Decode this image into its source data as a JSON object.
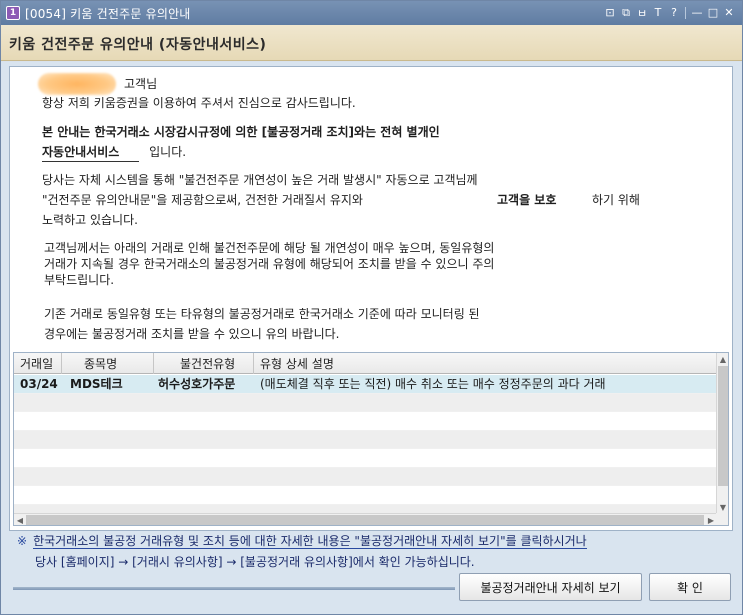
{
  "window": {
    "title": "[0054] 키움 건전주문 유의안내",
    "app_badge": "1",
    "tools": [
      "⊡",
      "⧉",
      "ㅂ",
      "T",
      "?",
      "—",
      "□",
      "✕"
    ]
  },
  "header": {
    "title": "키움 건전주문 유의안내 (자동안내서비스)"
  },
  "intro": {
    "customer_suffix": "고객님",
    "thanks": "항상 저희 키움증권을 이용하여 주셔서 진심으로 감사드립니다."
  },
  "notice": {
    "line1": "본 안내는 한국거래소 시장감시규정에 의한 [불공정거래 조치]와는 전혀 별개인",
    "line2_bold": "자동안내서비스",
    "line2_rest": "입니다."
  },
  "para1": {
    "line1": "당사는 자체 시스템을 통해 \"불건전주문 개연성이 높은 거래 발생시\" 자동으로 고객님께",
    "line2a": "\"건전주문 유의안내문\"을 제공함으로써, 건전한 거래질서 유지와",
    "line2_bold": "고객을 보호",
    "line2b": "하기 위해",
    "line3": "노력하고 있습니다."
  },
  "para2": {
    "line1": "고객님께서는 아래의 거래로 인해 불건전주문에 해당 될 개연성이 매우 높으며, 동일유형의",
    "line2": "거래가 지속될 경우 한국거래소의 불공정거래 유형에 해당되어 조치를 받을 수 있으니 주의",
    "line3": "부탁드립니다."
  },
  "para3": {
    "line1": "기존 거래로 동일유형 또는 타유형의 불공정거래로 한국거래소 기준에 따라 모니터링 된",
    "line2": "경우에는 불공정거래 조치를 받을 수 있으니 유의 바랍니다."
  },
  "grid": {
    "columns": [
      "거래일",
      "종목명",
      "불건전유형",
      "유형 상세 설명"
    ],
    "rows": [
      {
        "date": "03/24",
        "name": "MDS테크",
        "type": "허수성호가주문",
        "detail": "(매도체결 직후 또는 직전) 매수 취소 또는 매수 정정주문의 과다 거래"
      }
    ],
    "empty_row_count": 7
  },
  "footer_note": {
    "mark": "※",
    "line1": "한국거래소의 불공정 거래유형 및 조치 등에 대한 자세한 내용은 \"불공정거래안내 자세히 보기\"를 클릭하시거나",
    "line2": "당사 [홈페이지] → [거래시 유의사항] → [불공정거래 유의사항]에서 확인 가능하십니다."
  },
  "buttons": {
    "details": "불공정거래안내 자세히 보기",
    "confirm": "확  인"
  }
}
